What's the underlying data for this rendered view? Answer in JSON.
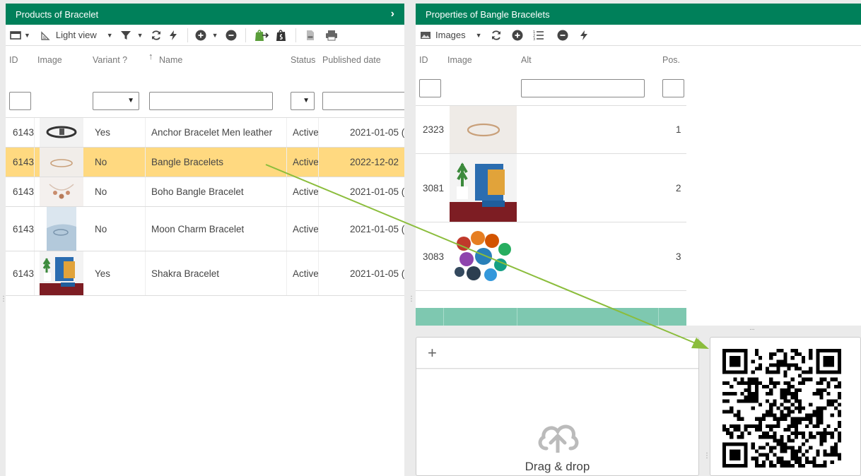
{
  "left_panel": {
    "title": "Products of Bracelet",
    "toolbar": {
      "view_label": "Light view"
    },
    "columns": {
      "id": "ID",
      "image": "Image",
      "variant": "Variant ?",
      "name": "Name",
      "status": "Status",
      "published": "Published date"
    },
    "rows": [
      {
        "id": "6143",
        "variant": "Yes",
        "name": "Anchor Bracelet Men leather",
        "status": "Active",
        "published": "2021-01-05 (",
        "selected": false
      },
      {
        "id": "6143",
        "variant": "No",
        "name": "Bangle Bracelets",
        "status": "Active",
        "published": "2022-12-02",
        "selected": true
      },
      {
        "id": "6143",
        "variant": "No",
        "name": "Boho Bangle Bracelet",
        "status": "Active",
        "published": "2021-01-05 (",
        "selected": false
      },
      {
        "id": "6143",
        "variant": "No",
        "name": "Moon Charm Bracelet",
        "status": "Active",
        "published": "2021-01-05 (",
        "selected": false
      },
      {
        "id": "6143",
        "variant": "Yes",
        "name": "Shakra Bracelet",
        "status": "Active",
        "published": "2021-01-05 (",
        "selected": false
      }
    ]
  },
  "right_panel": {
    "title": "Properties of Bangle Bracelets",
    "toolbar": {
      "view_label": "Images"
    },
    "columns": {
      "id": "ID",
      "image": "Image",
      "alt": "Alt",
      "pos": "Pos."
    },
    "rows": [
      {
        "id": "2323",
        "pos": "1"
      },
      {
        "id": "3081",
        "pos": "2"
      },
      {
        "id": "3083",
        "pos": "3"
      }
    ]
  },
  "upload": {
    "drag_label": "Drag & drop"
  },
  "colors": {
    "header_green": "#00805a",
    "selected_row": "#ffd980",
    "arrow": "#8bbd3c",
    "footer_teal": "#7ec8b0"
  },
  "icons": [
    "grid-layout-icon",
    "ruler-icon",
    "filter-icon",
    "refresh-icon",
    "lightning-icon",
    "add-circle-icon",
    "remove-circle-icon",
    "shopify-sync-icon",
    "shopify-bag-icon",
    "pdf-icon",
    "print-icon",
    "image-icon",
    "list-order-icon",
    "chevron-right-icon",
    "plus-icon",
    "cloud-upload-icon",
    "qr-code-icon"
  ]
}
